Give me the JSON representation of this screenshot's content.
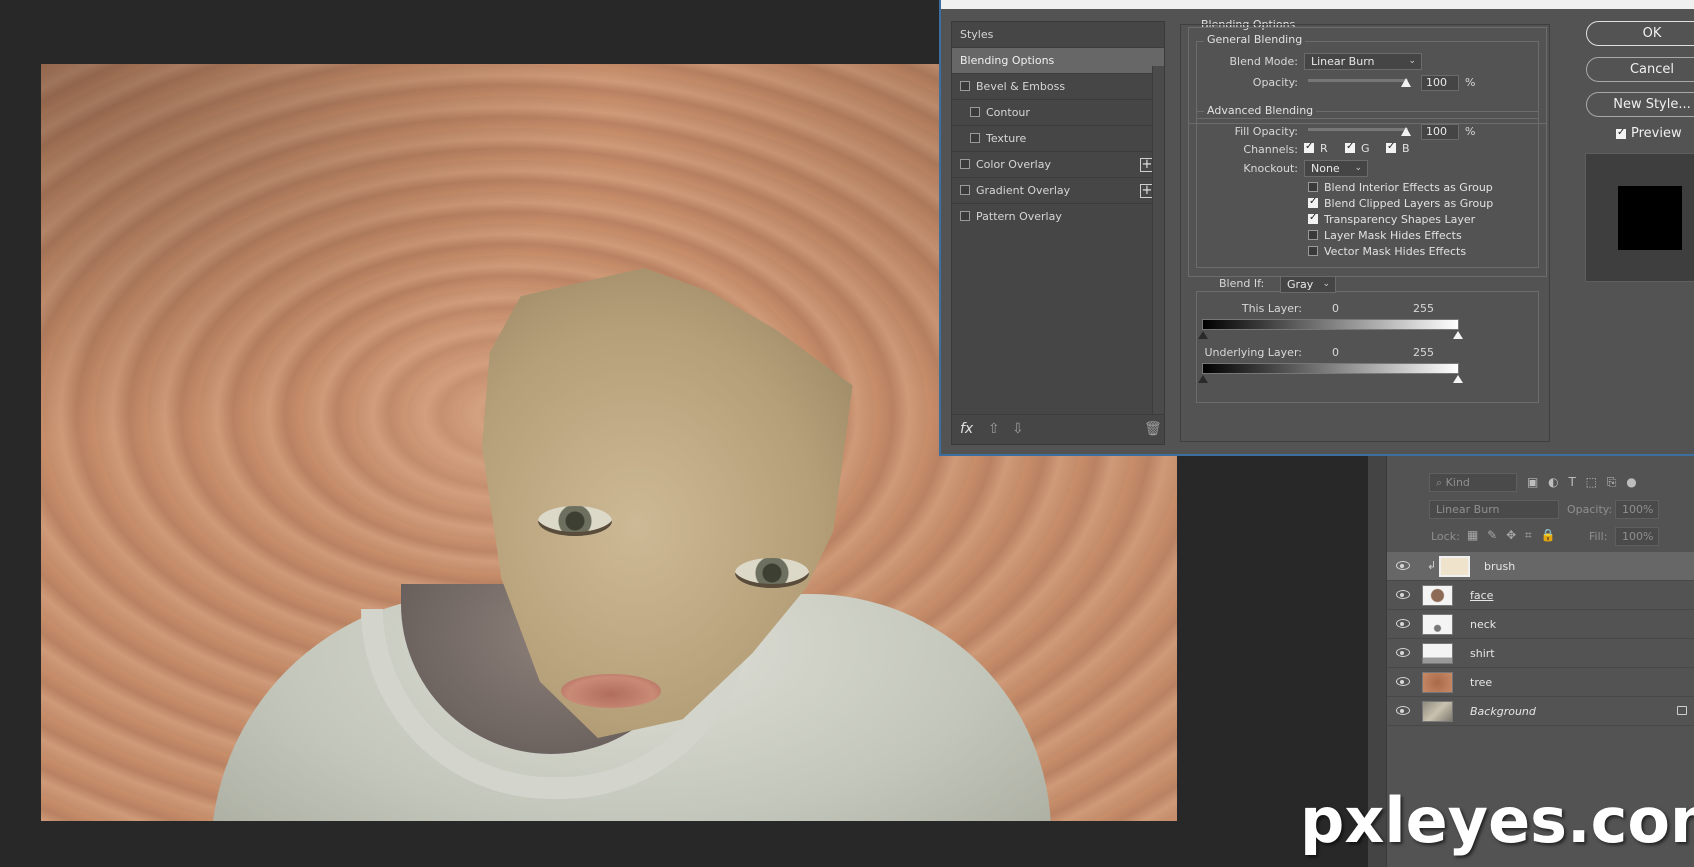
{
  "styles_panel": {
    "header": "Styles",
    "items": [
      {
        "label": "Blending Options",
        "selected": true,
        "checkbox": false,
        "indent": false,
        "plus": false
      },
      {
        "label": "Bevel & Emboss",
        "selected": false,
        "checkbox": true,
        "checked": false,
        "indent": false,
        "plus": false
      },
      {
        "label": "Contour",
        "selected": false,
        "checkbox": true,
        "checked": false,
        "indent": true,
        "plus": false
      },
      {
        "label": "Texture",
        "selected": false,
        "checkbox": true,
        "checked": false,
        "indent": true,
        "plus": false
      },
      {
        "label": "Color Overlay",
        "selected": false,
        "checkbox": true,
        "checked": false,
        "indent": false,
        "plus": true
      },
      {
        "label": "Gradient Overlay",
        "selected": false,
        "checkbox": true,
        "checked": false,
        "indent": false,
        "plus": true
      },
      {
        "label": "Pattern Overlay",
        "selected": false,
        "checkbox": true,
        "checked": false,
        "indent": false,
        "plus": false
      }
    ],
    "footer_fx": "fx"
  },
  "blending": {
    "section_title": "Blending Options",
    "general": {
      "title": "General Blending",
      "blend_mode_label": "Blend Mode:",
      "blend_mode_value": "Linear Burn",
      "opacity_label": "Opacity:",
      "opacity_value": "100",
      "percent": "%"
    },
    "advanced": {
      "title": "Advanced Blending",
      "fill_opacity_label": "Fill Opacity:",
      "fill_opacity_value": "100",
      "percent": "%",
      "channels_label": "Channels:",
      "channels": [
        {
          "label": "R",
          "checked": true
        },
        {
          "label": "G",
          "checked": true
        },
        {
          "label": "B",
          "checked": true
        }
      ],
      "knockout_label": "Knockout:",
      "knockout_value": "None",
      "options": [
        {
          "label": "Blend Interior Effects as Group",
          "checked": false
        },
        {
          "label": "Blend Clipped Layers as Group",
          "checked": true
        },
        {
          "label": "Transparency Shapes Layer",
          "checked": true
        },
        {
          "label": "Layer Mask Hides Effects",
          "checked": false
        },
        {
          "label": "Vector Mask Hides Effects",
          "checked": false
        }
      ]
    },
    "blend_if": {
      "label": "Blend If:",
      "value": "Gray",
      "this_layer_label": "This Layer:",
      "this_layer_low": "0",
      "this_layer_high": "255",
      "underlying_label": "Underlying Layer:",
      "underlying_low": "0",
      "underlying_high": "255"
    }
  },
  "buttons": {
    "ok": "OK",
    "cancel": "Cancel",
    "new_style": "New Style...",
    "preview": "Preview"
  },
  "layers_panel": {
    "filter_kind": "Kind",
    "blend_mode": "Linear Burn",
    "opacity_label": "Opacity:",
    "opacity_value": "100%",
    "lock_label": "Lock:",
    "fill_label": "Fill:",
    "fill_value": "100%",
    "layers": [
      {
        "name": "brush",
        "active": true,
        "italic": false,
        "locked": false
      },
      {
        "name": "face",
        "active": false,
        "italic": false,
        "locked": false
      },
      {
        "name": "neck",
        "active": false,
        "italic": false,
        "locked": false
      },
      {
        "name": "shirt",
        "active": false,
        "italic": false,
        "locked": false
      },
      {
        "name": "tree",
        "active": false,
        "italic": false,
        "locked": false
      },
      {
        "name": "Background",
        "active": false,
        "italic": true,
        "locked": true
      }
    ]
  },
  "watermark": "pxleyes.com",
  "colors": {
    "dialog_bg": "#535353",
    "app_bg": "#282828",
    "selected_row": "#676767",
    "dialog_border": "#3d6ea0"
  }
}
